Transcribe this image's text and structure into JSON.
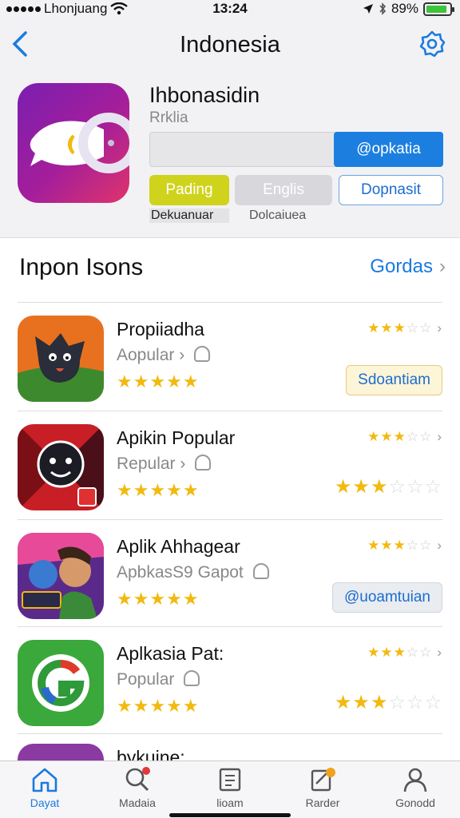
{
  "status_bar": {
    "carrier": "Lhonjuang",
    "time": "13:24",
    "battery": "89%",
    "battery_level": 0.89
  },
  "nav": {
    "title": "Indonesia"
  },
  "app": {
    "name": "Ihbonasidin",
    "subtitle": "Rrklia",
    "open_button": "@opkatia",
    "chips": [
      "Pading",
      "Englis",
      "Dopnasit"
    ],
    "chip_sublabels": [
      "Dekuanuar",
      "Dolcaiuea"
    ]
  },
  "section": {
    "title": "Inpon Isons",
    "link": "Gordas"
  },
  "rows": [
    {
      "name": "Propiiadha",
      "sub": "Aopular",
      "button": "Sdoantiam",
      "rating_small": 3,
      "rating_main": 5
    },
    {
      "name": "Apikin Popular",
      "sub": "Repular",
      "rating_small": 3,
      "rating_main": 4.5,
      "rating_large": 2.5
    },
    {
      "name": "Aplik Ahhagear",
      "sub": "ApbkasS9 Gapot",
      "button": "@uoamtuian",
      "rating_small": 3,
      "rating_main": 5
    },
    {
      "name": "Aplkasia Pat:",
      "sub": "Popular",
      "rating_small": 3,
      "rating_main": 5,
      "rating_large": 2.5
    },
    {
      "name": "bykuine:"
    }
  ],
  "tabs": [
    "Dayat",
    "Madaia",
    "lioam",
    "Rarder",
    "Gonodd"
  ],
  "colors": {
    "accent": "#1a7ae0",
    "star": "#f2b90f",
    "chip_yellow": "#cfd31c"
  }
}
